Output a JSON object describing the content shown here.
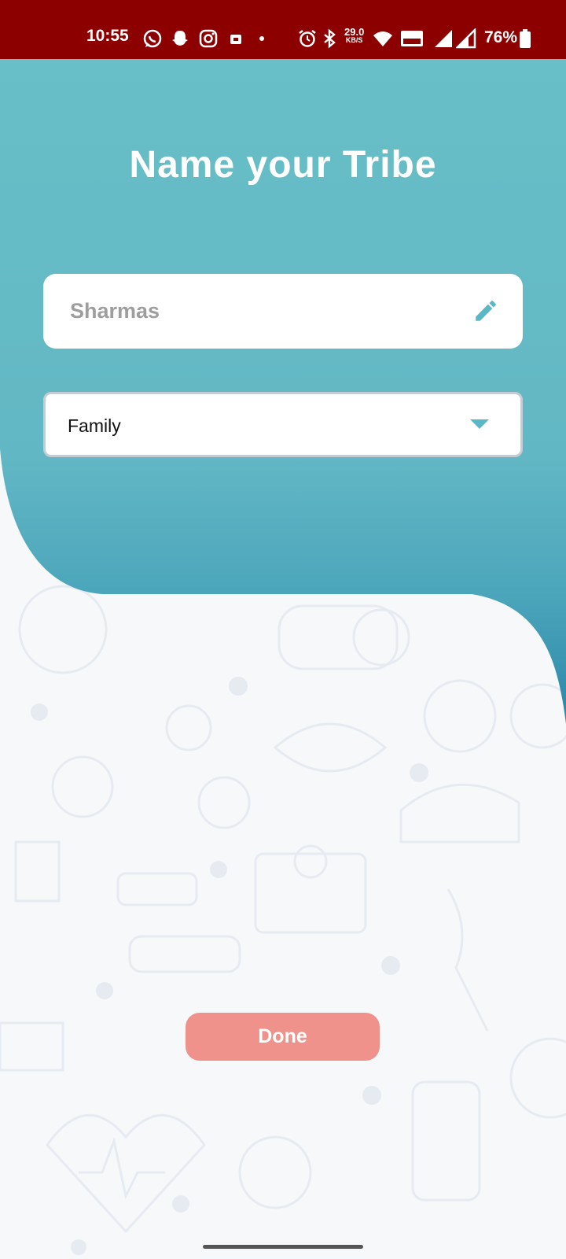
{
  "status_bar": {
    "time": "10:55",
    "network_speed_value": "29.0",
    "network_speed_unit": "KB/S",
    "battery": "76%"
  },
  "page": {
    "title": "Name your Tribe"
  },
  "tribe_name_field": {
    "value": "Sharmas"
  },
  "tribe_type_select": {
    "selected": "Family"
  },
  "done_button": {
    "label": "Done"
  },
  "colors": {
    "status_bar": "#8d0000",
    "header_gradient_top": "#68bfc7",
    "header_gradient_bottom": "#2f8dab",
    "done_button": "#ef928c",
    "accent_icon": "#5ab7c5"
  }
}
